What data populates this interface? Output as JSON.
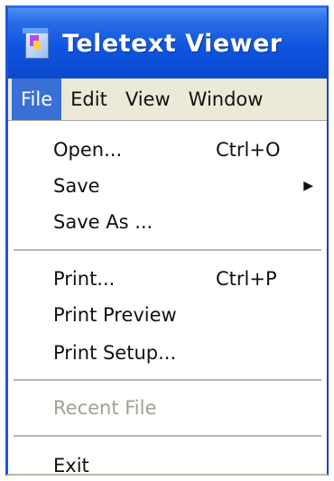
{
  "window": {
    "title": "Teletext Viewer",
    "icon": "teletext-app-icon"
  },
  "menubar": {
    "items": [
      "File",
      "Edit",
      "View",
      "Window"
    ],
    "active": "File"
  },
  "file_menu": {
    "open": {
      "label": "Open...",
      "shortcut": "Ctrl+O"
    },
    "save": {
      "label": "Save",
      "submenu_icon": "triangle-right-icon"
    },
    "save_as": {
      "label": "Save As ..."
    },
    "print": {
      "label": "Print...",
      "shortcut": "Ctrl+P"
    },
    "print_preview": {
      "label": "Print Preview"
    },
    "print_setup": {
      "label": "Print Setup..."
    },
    "recent_file": {
      "label": "Recent File",
      "disabled": true
    },
    "exit": {
      "label": "Exit"
    }
  },
  "colors": {
    "titlebar": "#0f54df",
    "menu_highlight": "#3a6fd6",
    "disabled_text": "#a3a196"
  }
}
